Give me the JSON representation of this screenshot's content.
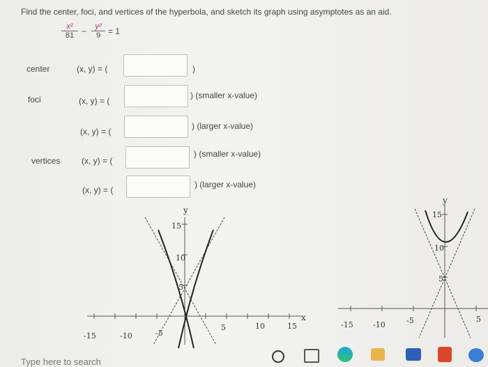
{
  "problem": {
    "instruction": "Find the center, foci, and vertices of the hyperbola, and sketch its graph using asymptotes as an aid.",
    "equation": {
      "term1_num": "x²",
      "term1_den": "81",
      "minus": "−",
      "term2_num": "y²",
      "term2_den": "9",
      "rhs": "= 1"
    }
  },
  "rows": [
    {
      "label": "center",
      "prefix": "(x, y) = (",
      "suffix": ")",
      "value": ""
    },
    {
      "label": "foci",
      "prefix": "(x, y) = (",
      "suffix": ") (smaller x-value)",
      "value": ""
    },
    {
      "label": "",
      "prefix": "(x, y) = (",
      "suffix": ") (larger x-value)",
      "value": ""
    },
    {
      "label": "vertices",
      "prefix": "(x, y) = (",
      "suffix": ") (smaller x-value)",
      "value": ""
    },
    {
      "label": "",
      "prefix": "(x, y) = (",
      "suffix": ") (larger x-value)",
      "value": ""
    }
  ],
  "graph_left": {
    "y_axis_label": "y",
    "x_axis_label": "x",
    "x_ticks": [
      "-15",
      "-10",
      "-5",
      "5",
      "10",
      "15"
    ],
    "y_ticks": [
      "15",
      "10",
      "5"
    ]
  },
  "graph_right": {
    "y_axis_label": "y",
    "x_ticks": [
      "-15",
      "-10",
      "-5",
      "5"
    ],
    "y_ticks": [
      "15",
      "10",
      "5"
    ]
  },
  "taskbar": {
    "search_placeholder": "Type here to search",
    "icons": [
      "cortana-icon",
      "task-view-icon",
      "edge-icon",
      "file-explorer-icon",
      "mail-icon",
      "office-icon",
      "store-icon"
    ]
  }
}
